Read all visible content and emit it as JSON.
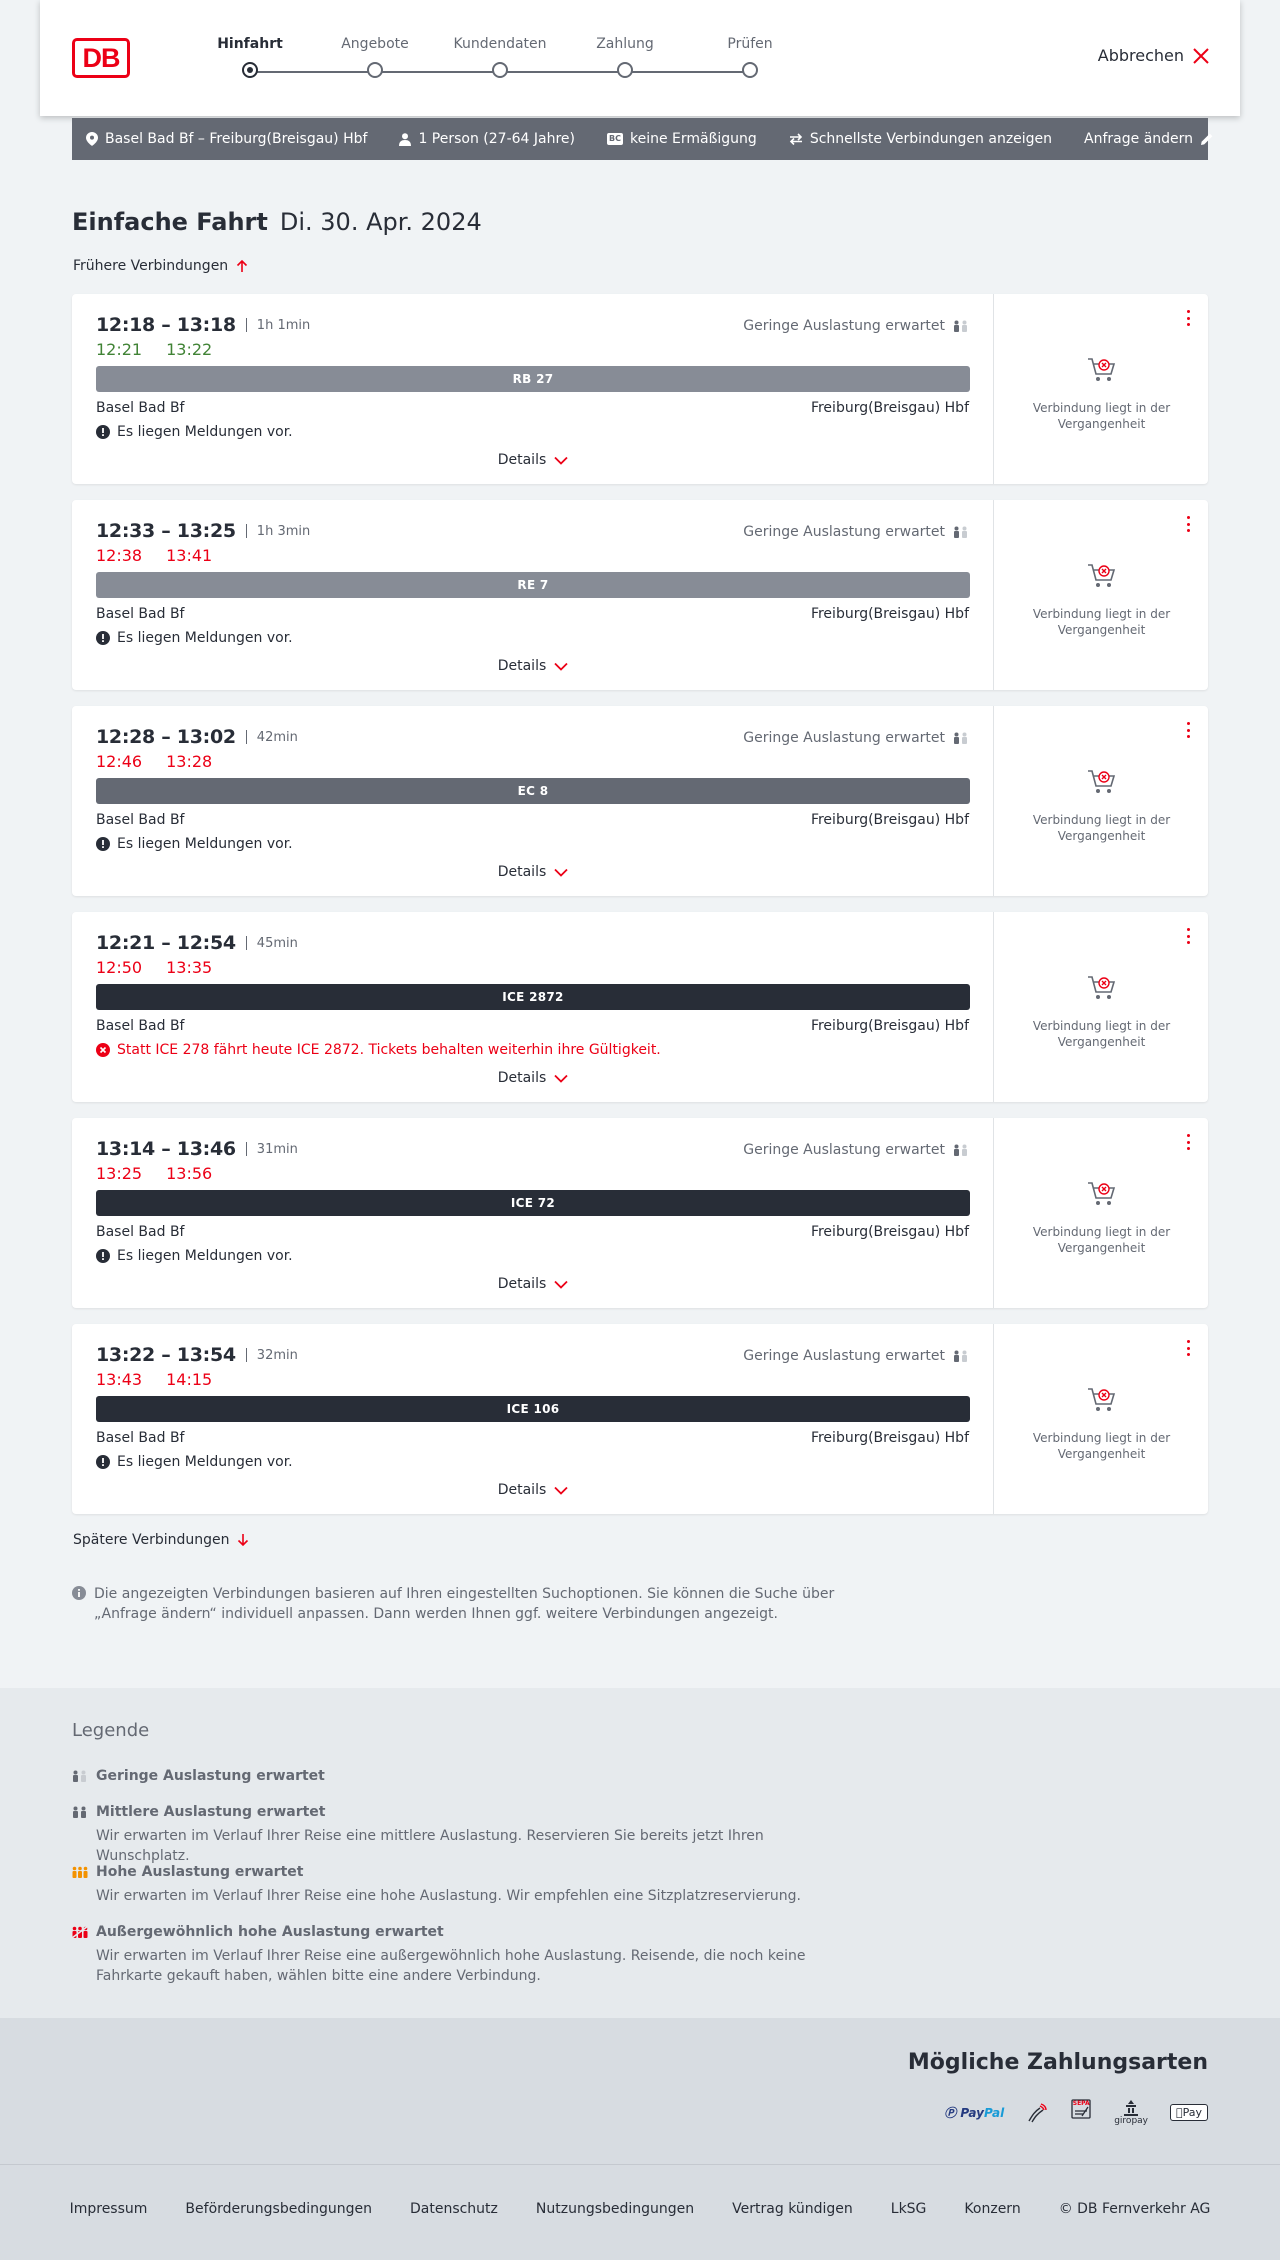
{
  "header": {
    "logo": "DB",
    "steps": [
      {
        "label": "Hinfahrt",
        "active": true
      },
      {
        "label": "Angebote",
        "active": false
      },
      {
        "label": "Kundendaten",
        "active": false
      },
      {
        "label": "Zahlung",
        "active": false
      },
      {
        "label": "Prüfen",
        "active": false
      }
    ],
    "cancel_label": "Abbrechen"
  },
  "search": {
    "route": "Basel Bad Bf – Freiburg(Breisgau) Hbf",
    "travellers": "1 Person (27-64 Jahre)",
    "discount_badge": "BC",
    "discount": "keine Ermäßigung",
    "fastest": "Schnellste Verbindungen anzeigen",
    "change_label": "Anfrage ändern"
  },
  "page": {
    "title": "Einfache Fahrt",
    "date": "Di. 30. Apr. 2024",
    "earlier_label": "Frühere Verbindungen",
    "later_label": "Spätere Verbindungen",
    "info_text": "Die angezeigten Verbindungen basieren auf Ihren eingestellten Suchoptionen. Sie können die Suche über „Anfrage ändern“ individuell anpassen. Dann werden Ihnen ggf. weitere Verbindungen angezeigt."
  },
  "connections": [
    {
      "planned": "12:18 – 13:18",
      "duration": "1h 1min",
      "rt_dep": "12:21",
      "rt_arr": "13:22",
      "rt_status": "ok",
      "load": "Geringe Auslastung erwartet",
      "train": "RB 27",
      "train_color": "#878c96",
      "from": "Basel Bad Bf",
      "to": "Freiburg(Breisgau) Hbf",
      "message": "Es liegen Meldungen vor.",
      "message_type": "info",
      "details_label": "Details",
      "past_text": "Verbindung liegt in der Vergangenheit"
    },
    {
      "planned": "12:33 – 13:25",
      "duration": "1h 3min",
      "rt_dep": "12:38",
      "rt_arr": "13:41",
      "rt_status": "late",
      "load": "Geringe Auslastung erwartet",
      "train": "RE 7",
      "train_color": "#878c96",
      "from": "Basel Bad Bf",
      "to": "Freiburg(Breisgau) Hbf",
      "message": "Es liegen Meldungen vor.",
      "message_type": "info",
      "details_label": "Details",
      "past_text": "Verbindung liegt in der Vergangenheit"
    },
    {
      "planned": "12:28 – 13:02",
      "duration": "42min",
      "rt_dep": "12:46",
      "rt_arr": "13:28",
      "rt_status": "late",
      "load": "Geringe Auslastung erwartet",
      "train": "EC 8",
      "train_color": "#646973",
      "from": "Basel Bad Bf",
      "to": "Freiburg(Breisgau) Hbf",
      "message": "Es liegen Meldungen vor.",
      "message_type": "info",
      "details_label": "Details",
      "past_text": "Verbindung liegt in der Vergangenheit"
    },
    {
      "planned": "12:21 – 12:54",
      "duration": "45min",
      "rt_dep": "12:50",
      "rt_arr": "13:35",
      "rt_status": "late",
      "load": "",
      "train": "ICE 2872",
      "train_color": "#282d37",
      "from": "Basel Bad Bf",
      "to": "Freiburg(Breisgau) Hbf",
      "message": "Statt ICE 278 fährt heute ICE 2872. Tickets behalten weiterhin ihre Gültigkeit.",
      "message_type": "warn",
      "details_label": "Details",
      "past_text": "Verbindung liegt in der Vergangenheit"
    },
    {
      "planned": "13:14 – 13:46",
      "duration": "31min",
      "rt_dep": "13:25",
      "rt_arr": "13:56",
      "rt_status": "late",
      "load": "Geringe Auslastung erwartet",
      "train": "ICE 72",
      "train_color": "#282d37",
      "from": "Basel Bad Bf",
      "to": "Freiburg(Breisgau) Hbf",
      "message": "Es liegen Meldungen vor.",
      "message_type": "info",
      "details_label": "Details",
      "past_text": "Verbindung liegt in der Vergangenheit"
    },
    {
      "planned": "13:22 – 13:54",
      "duration": "32min",
      "rt_dep": "13:43",
      "rt_arr": "14:15",
      "rt_status": "late",
      "load": "Geringe Auslastung erwartet",
      "train": "ICE 106",
      "train_color": "#282d37",
      "from": "Basel Bad Bf",
      "to": "Freiburg(Breisgau) Hbf",
      "message": "Es liegen Meldungen vor.",
      "message_type": "info",
      "details_label": "Details",
      "past_text": "Verbindung liegt in der Vergangenheit"
    }
  ],
  "legend": {
    "title": "Legende",
    "items": [
      {
        "label": "Geringe Auslastung erwartet",
        "desc": "",
        "icon": "load-low-icon"
      },
      {
        "label": "Mittlere Auslastung erwartet",
        "desc": "Wir erwarten im Verlauf Ihrer Reise eine mittlere Auslastung. Reservieren Sie bereits jetzt Ihren Wunschplatz.",
        "icon": "load-medium-icon"
      },
      {
        "label": "Hohe Auslastung erwartet",
        "desc": "Wir erwarten im Verlauf Ihrer Reise eine hohe Auslastung. Wir empfehlen eine Sitzplatzreservierung.",
        "icon": "load-high-icon"
      },
      {
        "label": "Außergewöhnlich hohe Auslastung erwartet",
        "desc": "Wir erwarten im Verlauf Ihrer Reise eine außergewöhnlich hohe Auslastung. Reisende, die noch keine Fahrkarte gekauft haben, wählen bitte eine andere Verbindung.",
        "icon": "load-extreme-icon"
      }
    ]
  },
  "payment": {
    "title": "Mögliche Zahlungsarten",
    "paypal_a": "Pay",
    "paypal_b": "Pal",
    "sepa": "SEPA",
    "giropay": "giropay",
    "applepay": "Pay"
  },
  "footer": {
    "links": [
      "Impressum",
      "Beförderungsbedingungen",
      "Datenschutz",
      "Nutzungsbedingungen",
      "Vertrag kündigen",
      "LkSG",
      "Konzern"
    ],
    "copyright": "© DB Fernverkehr AG"
  },
  "colors": {
    "brand": "#ec0016",
    "ontime": "#408335",
    "text": "#282d37",
    "muted": "#646973",
    "load_high": "#f39200"
  }
}
